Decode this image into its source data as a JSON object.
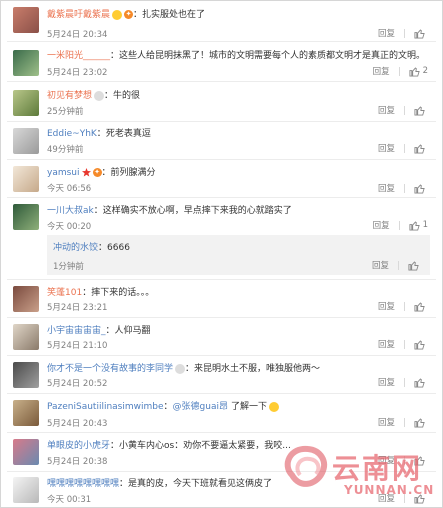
{
  "comments": [
    {
      "user": "戴紫晨吁戴紫晨",
      "sep": "：",
      "text": "扎实服处也在了",
      "time": "5月24日 20:34",
      "reply": "回复",
      "likes": ""
    },
    {
      "user": "一米阳光______",
      "sep": "：",
      "text": "这些人给昆明抹黑了！城市的文明需要每个人的素质都文明才是真正的文明。",
      "time": "5月24日 23:02",
      "reply": "回复",
      "likes": "2"
    },
    {
      "user": "初见有梦想",
      "sep": "：",
      "text": "牛的很",
      "time": "25分钟前",
      "reply": "回复",
      "likes": ""
    },
    {
      "user": "Eddie~YhK",
      "sep": "：",
      "text": "死老表真逗",
      "time": "49分钟前",
      "reply": "回复",
      "likes": ""
    },
    {
      "user": "yamsui",
      "sep": "：",
      "text": "前列腺满分",
      "time": "今天 06:56",
      "reply": "回复",
      "likes": ""
    },
    {
      "user": "一川大叔ak",
      "sep": "：",
      "text": "这样确实不放心啊，早点摔下来我的心就踏实了",
      "time": "今天 00:20",
      "reply": "回复",
      "likes": "1"
    },
    {
      "user": "笑蓬101",
      "sep": "：",
      "text": "摔下来的话。。。",
      "time": "5月24日 23:21",
      "reply": "回复",
      "likes": ""
    },
    {
      "user": "小宇宙宙宙宙_",
      "sep": "：",
      "text": "人仰马翻",
      "time": "5月24日 21:10",
      "reply": "回复",
      "likes": ""
    },
    {
      "user": "你才不是一个没有故事的李同学",
      "sep": "：",
      "text": "来昆明水土不服，唯独服他两～",
      "time": "5月24日 20:52",
      "reply": "回复",
      "likes": ""
    },
    {
      "user": "PazeniSautiilinasimwimbe",
      "sep": "：",
      "mention": "@张德guai昂",
      "text": "了解一下",
      "time": "5月24日 20:43",
      "reply": "回复",
      "likes": ""
    },
    {
      "user": "单眼皮的小虎牙",
      "sep": "：",
      "text": "小黄车内心os：劝你不要逼太紧要，我咬...",
      "time": "5月24日 20:38",
      "reply": "回复",
      "likes": ""
    },
    {
      "user": "嘿嘿嘿嘿嘿嘿嘿嘿",
      "sep": "：",
      "text": "是真的皮，今天下班就看见这俩皮了",
      "time": "今天 00:31",
      "reply": "回复",
      "likes": ""
    }
  ],
  "nested_reply": {
    "user": "冲动的水饺",
    "sep": "：",
    "text": "6666",
    "time": "1分钟前",
    "reply": "回复",
    "likes": ""
  },
  "watermark": {
    "brand": "云南网",
    "domain": "YUNNAN.CN"
  }
}
